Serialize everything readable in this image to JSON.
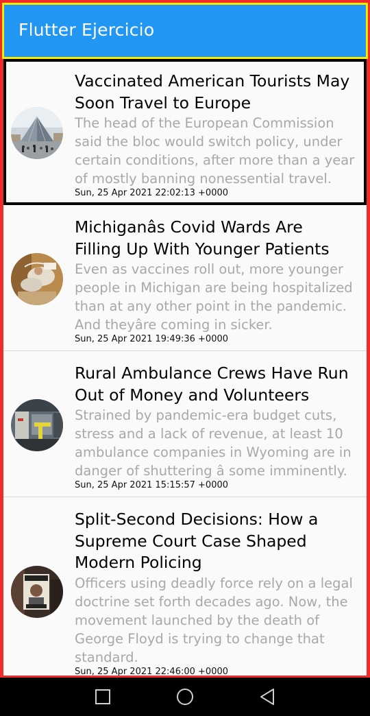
{
  "appbar": {
    "title": "Flutter Ejercicio"
  },
  "colors": {
    "appbar": "#2196f3",
    "appbar_border": "#ffeb00",
    "frame": "#ef2b2b",
    "selected_border": "#000000",
    "title": "#000000",
    "description": "#a8a8a8",
    "navbar": "#000000"
  },
  "articles": [
    {
      "title_lines": [
        "Vaccinated American Tourists May",
        "Soon Travel to Europe"
      ],
      "description_lines": [
        "The head of the European Commission",
        "said the bloc would switch policy, under",
        "certain conditions, after more than a year",
        "of mostly banning nonessential travel."
      ],
      "date": "Sun, 25 Apr 2021 22:02:13 +0000",
      "thumbnail": "louvre-pyramid-photo",
      "selected": true
    },
    {
      "title_lines": [
        "Michiganâs Covid Wards Are",
        "Filling Up With Younger Patients"
      ],
      "description_lines": [
        "Even as vaccines roll out, more younger",
        "people in Michigan are being hospitalized",
        "than at any other point in the pandemic.",
        "And theyâre coming in sicker."
      ],
      "date": "Sun, 25 Apr 2021 19:49:36 +0000",
      "thumbnail": "hospital-patient-photo",
      "selected": false
    },
    {
      "title_lines": [
        "Rural Ambulance Crews Have Run",
        "Out of Money and Volunteers"
      ],
      "description_lines": [
        "Strained by pandemic-era budget cuts,",
        "stress and a lack of revenue, at least 10",
        "ambulance companies in Wyoming are in",
        "danger of shuttering â some imminently."
      ],
      "date": "Sun, 25 Apr 2021 15:15:57 +0000",
      "thumbnail": "ambulance-interior-photo",
      "selected": false
    },
    {
      "title_lines": [
        "Split-Second Decisions: How a",
        "Supreme Court Case Shaped",
        "Modern Policing"
      ],
      "description_lines": [
        "Officers using deadly force rely on a legal",
        "doctrine set forth decades ago. Now, the",
        "movement launched by the death of",
        "George Floyd is trying to change that",
        "standard."
      ],
      "date": "Sun, 25 Apr 2021 22:46:00 +0000",
      "thumbnail": "protest-sign-photo",
      "selected": false
    }
  ],
  "navbar": {
    "buttons": [
      "recent-apps-icon",
      "home-icon",
      "back-icon"
    ]
  }
}
